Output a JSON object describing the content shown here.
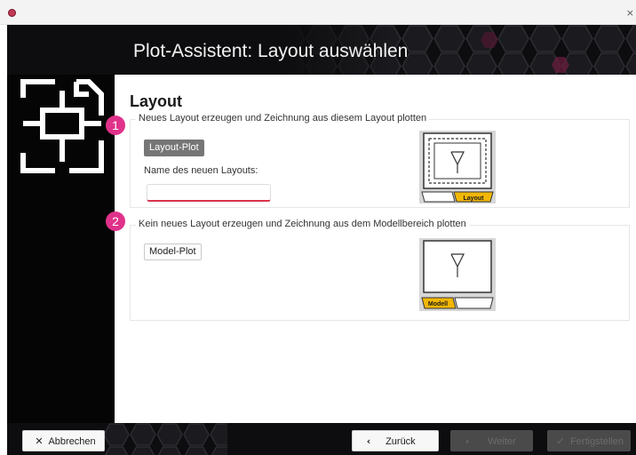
{
  "window": {
    "close_glyph": "×"
  },
  "header": {
    "title": "Plot-Assistent: Layout auswählen"
  },
  "main": {
    "section_title": "Layout",
    "option1": {
      "badge": "1",
      "legend": "Neues Layout erzeugen und Zeichnung aus diesem Layout plotten",
      "button_label": "Layout-Plot",
      "field_label": "Name des neuen Layouts:",
      "field_value": "",
      "tab_label": "Layout"
    },
    "option2": {
      "badge": "2",
      "legend": "Kein neues Layout erzeugen und Zeichnung aus dem Modellbereich plotten",
      "button_label": "Model-Plot",
      "tab_label": "Modell"
    }
  },
  "footer": {
    "cancel_label": "Abbrechen",
    "back_label": "Zurück",
    "next_label": "Weiter",
    "finish_label": "Fertigstellen"
  },
  "icons": {
    "app": "app-logo-icon",
    "close": "close-icon",
    "wizard": "layout-frame-icon",
    "cancel": "x-icon",
    "back": "chevron-left-icon",
    "next": "chevron-right-icon",
    "finish": "checkmark-icon"
  },
  "colors": {
    "accent_badge": "#e0328a",
    "input_underline": "#d9344c",
    "tab_highlight": "#f2b705",
    "header_bg": "#0d0d0f"
  }
}
